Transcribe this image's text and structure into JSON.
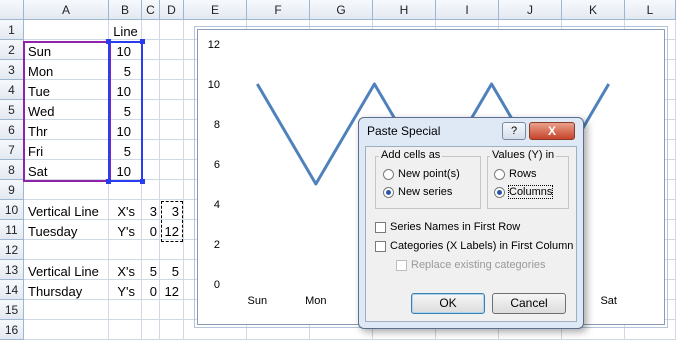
{
  "columns": [
    "A",
    "B",
    "C",
    "D",
    "E",
    "F",
    "G",
    "H",
    "I",
    "J",
    "K",
    "L"
  ],
  "rows": [
    "1",
    "2",
    "3",
    "4",
    "5",
    "6",
    "7",
    "8",
    "9",
    "10",
    "11",
    "12",
    "13",
    "14",
    "15",
    "16"
  ],
  "cells": {
    "b1": "Line",
    "a2": "Sun",
    "b2": "10",
    "a3": "Mon",
    "b3": "5",
    "a4": "Tue",
    "b4": "10",
    "a5": "Wed",
    "b5": "5",
    "a6": "Thr",
    "b6": "10",
    "a7": "Fri",
    "b7": "5",
    "a8": "Sat",
    "b8": "10",
    "a10": "Vertical Line",
    "b10": "X's",
    "c10": "3",
    "d10": "3",
    "a11": "Tuesday",
    "b11": "Y's",
    "c11": "0",
    "d11": "12",
    "a13": "Vertical Line",
    "b13": "X's",
    "c13": "5",
    "d13": "5",
    "a14": "Thursday",
    "b14": "Y's",
    "c14": "0",
    "d14": "12"
  },
  "chart_data": {
    "type": "line",
    "categories": [
      "Sun",
      "Mon",
      "Tue",
      "Wed",
      "Thr",
      "Fri",
      "Sat"
    ],
    "series": [
      {
        "values": [
          10,
          5,
          10,
          5,
          10,
          5,
          10
        ],
        "color": "#4f81bd"
      }
    ],
    "ylim": [
      0,
      12
    ],
    "yticks": [
      "12",
      "10",
      "8",
      "6",
      "4",
      "2",
      "0"
    ],
    "x_visible_labels": [
      "Sun",
      "Mon",
      "Sat"
    ],
    "grid": false
  },
  "dialog": {
    "title": "Paste Special",
    "help": "?",
    "close": "X",
    "add_cells_as": {
      "label": "Add cells as",
      "options": [
        {
          "label": "New point(s)",
          "selected": false
        },
        {
          "label": "New series",
          "selected": true
        }
      ]
    },
    "values_in": {
      "label": "Values (Y) in",
      "options": [
        {
          "label": "Rows",
          "selected": false
        },
        {
          "label": "Columns",
          "selected": true
        }
      ]
    },
    "series_names_label": "Series Names in First Row",
    "categories_label": "Categories (X Labels) in First Column",
    "replace_label": "Replace existing categories",
    "ok_label": "OK",
    "cancel_label": "Cancel"
  }
}
